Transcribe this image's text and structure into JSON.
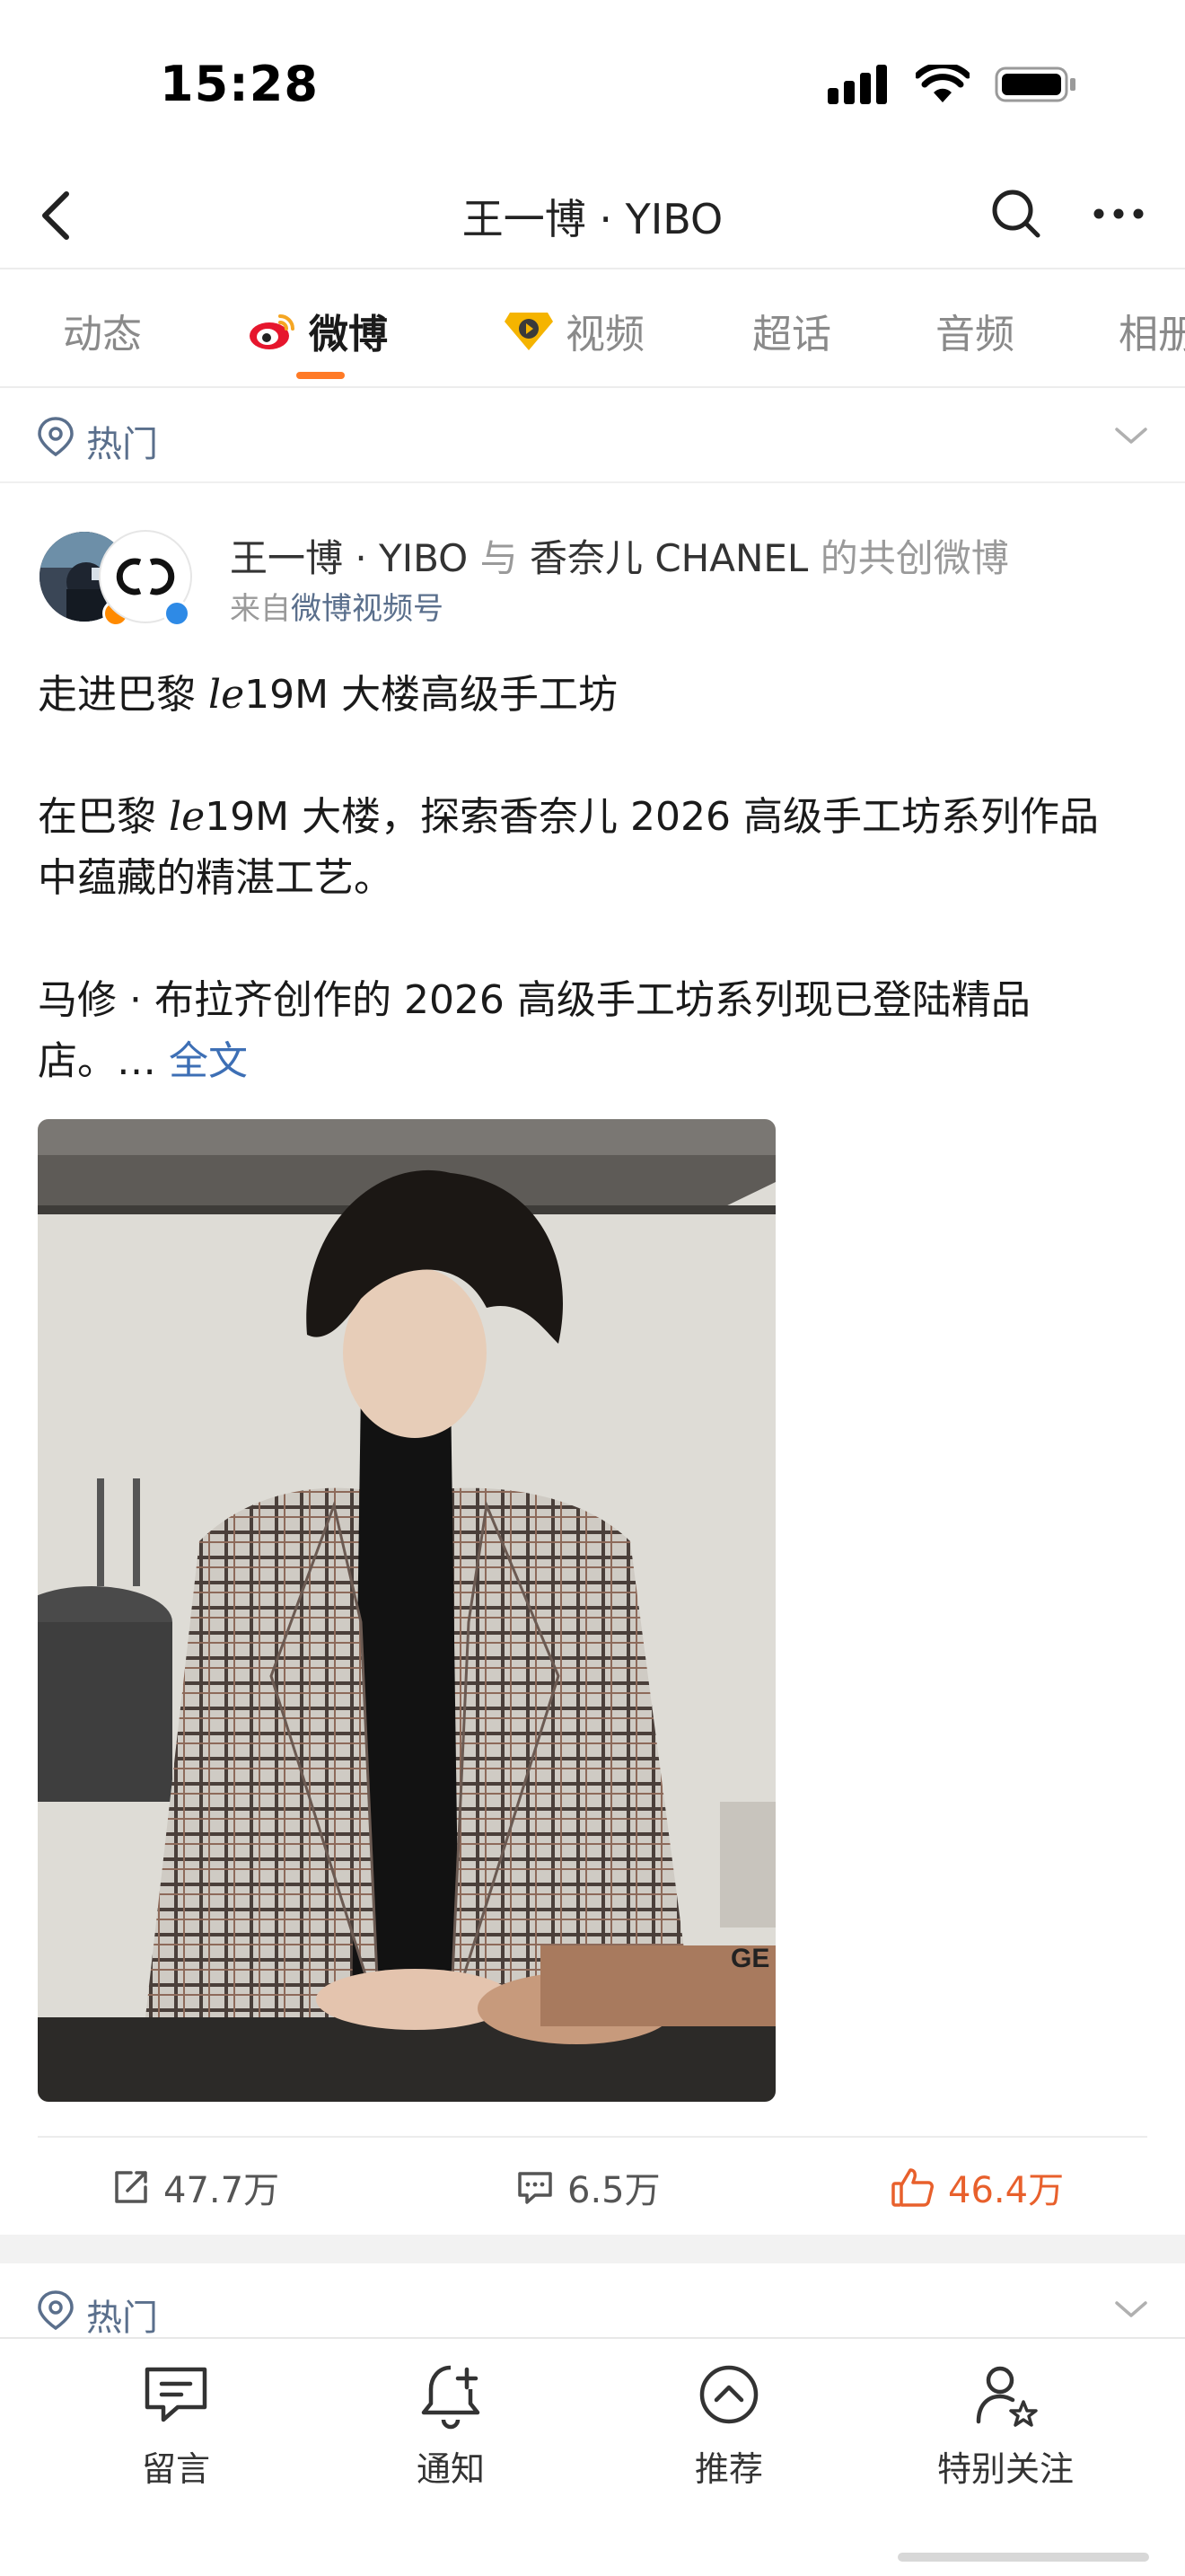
{
  "status_bar": {
    "time": "15:28"
  },
  "nav": {
    "title": "王一博 · YIBO",
    "icons": [
      "back-arrow-icon",
      "search-icon",
      "more-icon"
    ]
  },
  "tabs": [
    {
      "label": "动态",
      "active": false
    },
    {
      "label": "微博",
      "active": true
    },
    {
      "label": "视频",
      "active": false
    },
    {
      "label": "超话",
      "active": false
    },
    {
      "label": "音频",
      "active": false
    },
    {
      "label": "相册",
      "active": false
    }
  ],
  "section": {
    "label": "热门"
  },
  "post": {
    "author": "王一博 · YIBO",
    "connector": "与",
    "coauthor": "香奈儿 CHANEL",
    "cocreate_suffix": "的共创微博",
    "source_prefix": "来自",
    "source": "微博视频号",
    "text": {
      "p1_a": "走进巴黎 ",
      "p1_it": "le",
      "p1_b": "19M 大楼高级手工坊",
      "p2_a": "在巴黎 ",
      "p2_it": "le",
      "p2_b": "19M 大楼，探索香奈儿 2026 高级手工坊系列作品",
      "p2_c": "中蕴藏的精湛工艺。",
      "p3_a": "马修 · 布拉齐创作的 2026 高级手工坊系列现已登陆精品",
      "p3_b": "店。…",
      "full_link": "全文"
    },
    "image_text": "GE",
    "actions": {
      "repost": "47.7万",
      "comment": "6.5万",
      "like": "46.4万"
    }
  },
  "section2": {
    "label": "热门"
  },
  "bottom_bar": [
    {
      "label": "留言",
      "icon": "message-icon"
    },
    {
      "label": "通知",
      "icon": "bell-add-icon"
    },
    {
      "label": "推荐",
      "icon": "up-circle-icon"
    },
    {
      "label": "特别关注",
      "icon": "person-star-icon"
    }
  ],
  "colors": {
    "accent_orange": "#ff7a26",
    "link_blue": "#3d6fb5",
    "like_red": "#e8602c",
    "muted_blue": "#5a6f8c"
  }
}
